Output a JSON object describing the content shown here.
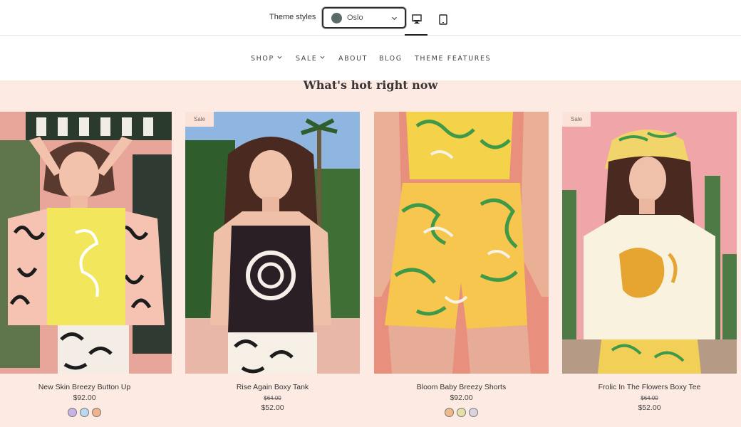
{
  "theme_bar": {
    "label": "Theme styles",
    "selected_style": "Oslo",
    "style_color": "#5a6b68",
    "devices": [
      {
        "name": "desktop",
        "icon": "desktop-icon",
        "active": true
      },
      {
        "name": "mobile",
        "icon": "mobile-icon",
        "active": false
      }
    ]
  },
  "nav": {
    "items": [
      {
        "label": "SHOP",
        "has_dropdown": true
      },
      {
        "label": "SALE",
        "has_dropdown": true
      },
      {
        "label": "ABOUT",
        "has_dropdown": false
      },
      {
        "label": "BLOG",
        "has_dropdown": false
      },
      {
        "label": "THEME FEATURES",
        "has_dropdown": false
      }
    ]
  },
  "section": {
    "title": "What's hot right now",
    "background": "#fdebe3"
  },
  "products": [
    {
      "name": "New Skin Breezy Button Up",
      "price": "$92.00",
      "sale": false,
      "image_icon": "woman-in-print-shirt-photo",
      "swatches": [
        "#c9b2e6",
        "#bcd8ef",
        "#efb38d"
      ]
    },
    {
      "name": "Rise Again Boxy Tank",
      "badge": "Sale",
      "original_price": "$64.00",
      "price": "$52.00",
      "sale": true,
      "image_icon": "woman-in-black-tank-photo",
      "swatches": []
    },
    {
      "name": "Bloom Baby Breezy Shorts",
      "price": "$92.00",
      "sale": false,
      "image_icon": "floral-shorts-photo",
      "swatches": [
        "#f0b98a",
        "#e7e0a6",
        "#dcd3df"
      ]
    },
    {
      "name": "Frolic In The Flowers Boxy Tee",
      "badge": "Sale",
      "original_price": "$64.00",
      "price": "$52.00",
      "sale": true,
      "image_icon": "woman-in-cream-tee-photo",
      "swatches": []
    }
  ]
}
